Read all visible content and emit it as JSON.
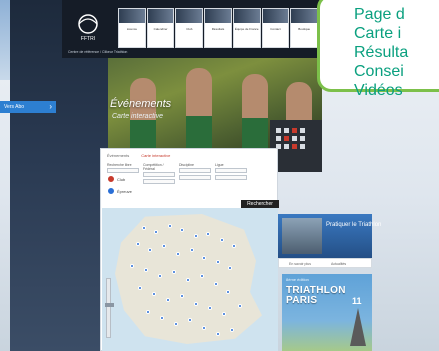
{
  "header": {
    "logo_sub": "Centre de référence / Clikeur Triathlon",
    "nav": [
      {
        "label": "Licence"
      },
      {
        "label": "Calendrier"
      },
      {
        "label": "Club"
      },
      {
        "label": "Résultats"
      },
      {
        "label": "Équipe de France"
      },
      {
        "label": "Contact"
      },
      {
        "label": "Boutique"
      }
    ]
  },
  "sidebar": {
    "button_label": "Vers Abo"
  },
  "hero": {
    "title": "Événements",
    "subtitle": "Carte interactive"
  },
  "panel": {
    "tabs": [
      {
        "label": "Événements",
        "active": false
      },
      {
        "label": "Carte interactive",
        "active": true
      }
    ],
    "filters": [
      {
        "label": "Recherche libre"
      },
      {
        "label": "Compétition / Fédéral"
      },
      {
        "label": "Discipline"
      },
      {
        "label": "Ligue"
      }
    ],
    "legend": [
      {
        "label": "Club",
        "color": "#c73a2c"
      },
      {
        "label": "Épreuve",
        "color": "#2a6fd6"
      }
    ],
    "search_button": "Rechercher",
    "map": {
      "country": "France",
      "pin_color": "#2a6fd6"
    }
  },
  "right": {
    "pratiquer": "Pratiquer le Triathlon",
    "mini_tabs": [
      "En savoir plus",
      "Actualités"
    ],
    "ad": {
      "pre": "8ème édition",
      "title_line1": "TRIATHLON",
      "title_line2": "PARIS",
      "year": "11"
    }
  },
  "callout": {
    "items": [
      "Page d",
      "Carte i",
      "Résulta",
      "Consei",
      "Vidéos"
    ],
    "color": "#0aa07f",
    "border_color": "#7cc04a"
  }
}
